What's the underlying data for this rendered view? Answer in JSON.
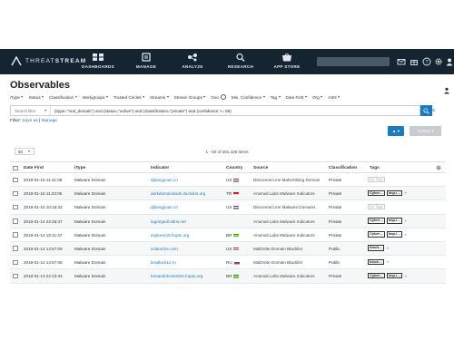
{
  "app": {
    "brand_light": "THREAT",
    "brand_bold": "STREAM"
  },
  "nav": {
    "items": [
      {
        "id": "dashboards",
        "label": "DASHBOARDS",
        "icon": "dashboard-icon"
      },
      {
        "id": "manage",
        "label": "MANAGE",
        "icon": "manage-icon"
      },
      {
        "id": "analyze",
        "label": "ANALYZE",
        "icon": "analyze-icon"
      },
      {
        "id": "research",
        "label": "RESEARCH",
        "icon": "research-icon"
      },
      {
        "id": "appstore",
        "label": "APP STORE",
        "icon": "app-store-icon"
      }
    ],
    "right_icons": [
      "mail-icon",
      "gift-icon",
      "help-icon",
      "settings-icon",
      "user-icon"
    ],
    "accent": "#142431"
  },
  "page": {
    "title": "Observables"
  },
  "filters": {
    "items": [
      "iType",
      "Status",
      "Classification",
      "Workgroups",
      "Trusted Circles",
      "Streams",
      "Stream Groups"
    ],
    "geo": "Geo",
    "items2": [
      "Min. Confidence",
      "Tag",
      "Date First",
      "Org",
      "ASN"
    ]
  },
  "query": {
    "filter_placeholder": "Search filter",
    "text": "(itype=\"mal_domain\") and (status=\"active\") and (classification=\"private\") and (confidence >= 95)",
    "basic_link": "Basic"
  },
  "save": {
    "prefix": "Filter:",
    "save_as": "Save as",
    "separator": "|",
    "manage": "Manage"
  },
  "actions": {
    "primary_label": "▲·▾",
    "secondary_label": "Actions ▾"
  },
  "paging": {
    "per_page": "50",
    "summary": "1 - 50 of 291,426 items"
  },
  "table": {
    "columns": [
      "Date First",
      "iType",
      "Indicator",
      "Country",
      "Source",
      "Classification",
      "Tags"
    ],
    "rows": [
      {
        "date": "2018-01-15 11:41:05",
        "itype": "Malware Domain",
        "indicator": "djbangyuan.cn",
        "country": "US",
        "flag": "us",
        "source": "Disconnect.me Malvertising Domain",
        "classification": "Private",
        "tags": [],
        "notag": "No Tags"
      },
      {
        "date": "2018-01-15 11:33:06",
        "itype": "Malware Domain",
        "indicator": "darkdomainduds.duckdns.org",
        "country": "TR",
        "flag": "tr",
        "source": "Anomali Labs Malware Indicators",
        "classification": "Private",
        "tags": [
          "Cyber…",
          "imp-i…"
        ]
      },
      {
        "date": "2018-01-15 10:16:42",
        "itype": "Malware Domain",
        "indicator": "djbangyuan.cn",
        "country": "US",
        "flag": "us",
        "source": "Disconnect.me Malware Domains",
        "classification": "Private",
        "tags": [],
        "notag": "No Tags"
      },
      {
        "date": "2018-01-14 22:26:47",
        "itype": "Malware Domain",
        "indicator": "lagriegedl.ddns.net",
        "country": "",
        "flag": "",
        "source": "Anomali Labs Malware Indicators",
        "classification": "Private",
        "tags": [
          "Cyber…",
          "imp-i…"
        ]
      },
      {
        "date": "2018-01-14 16:11:47",
        "itype": "Malware Domain",
        "indicator": "explorer18.hopto.org",
        "country": "BR",
        "flag": "br",
        "source": "Anomali Labs Malware Indicators",
        "classification": "Private",
        "tags": [
          "Cyber…",
          "imp-i…"
        ]
      },
      {
        "date": "2018-01-14 14:57:09",
        "itype": "Malware Domain",
        "indicator": "icdarache.com",
        "country": "US",
        "flag": "us",
        "source": "MalDSite Domain Blacklist",
        "classification": "Public",
        "tags": [
          "block…"
        ]
      },
      {
        "date": "2018-01-14 14:57:08",
        "itype": "Malware Domain",
        "indicator": "bradlack12.ru",
        "country": "RU",
        "flag": "ru",
        "source": "MalDSite Domain Blacklist",
        "classification": "Public",
        "tags": [
          "block…"
        ]
      },
      {
        "date": "2018-01-13 22:13:34",
        "itype": "Malware Domain",
        "indicator": "tomandohost3334.hopto.org",
        "country": "BR",
        "flag": "br",
        "source": "Anomali Labs Malware Indicators",
        "classification": "Private",
        "tags": [
          "Cyber…",
          "imp-i…"
        ]
      }
    ]
  },
  "colors": {
    "link": "#1d7abf",
    "primary_button": "#1d7abf",
    "nav_bg": "#142431"
  }
}
